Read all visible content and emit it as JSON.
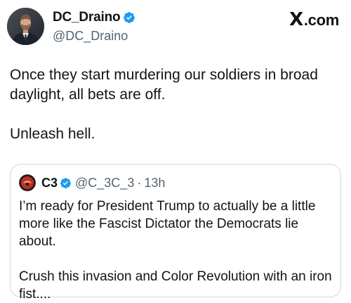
{
  "tweet": {
    "author": {
      "display_name": "DC_Draino",
      "handle": "@DC_Draino",
      "verified": true,
      "avatar_icon": "avatar-man-in-suit"
    },
    "site_label": "com",
    "site_mark": "X",
    "body": [
      "Once they start murdering our soldiers in broad daylight, all bets are off.",
      "Unleash hell."
    ],
    "quote": {
      "display_name": "C3",
      "handle": "@C_3C_3",
      "separator": "·",
      "time": "13h",
      "verified": true,
      "avatar_icon": "avatar-red-logo",
      "body": [
        "I’m ready for President Trump to actually be a little more like the Fascist Dictator the Democrats lie about.",
        "Crush this invasion and Color Revolution with an iron fist...."
      ]
    }
  },
  "colors": {
    "verified_blue": "#1d9bf0",
    "secondary_text": "#536471",
    "border": "#cfd9de",
    "primary_text": "#0f1419"
  }
}
